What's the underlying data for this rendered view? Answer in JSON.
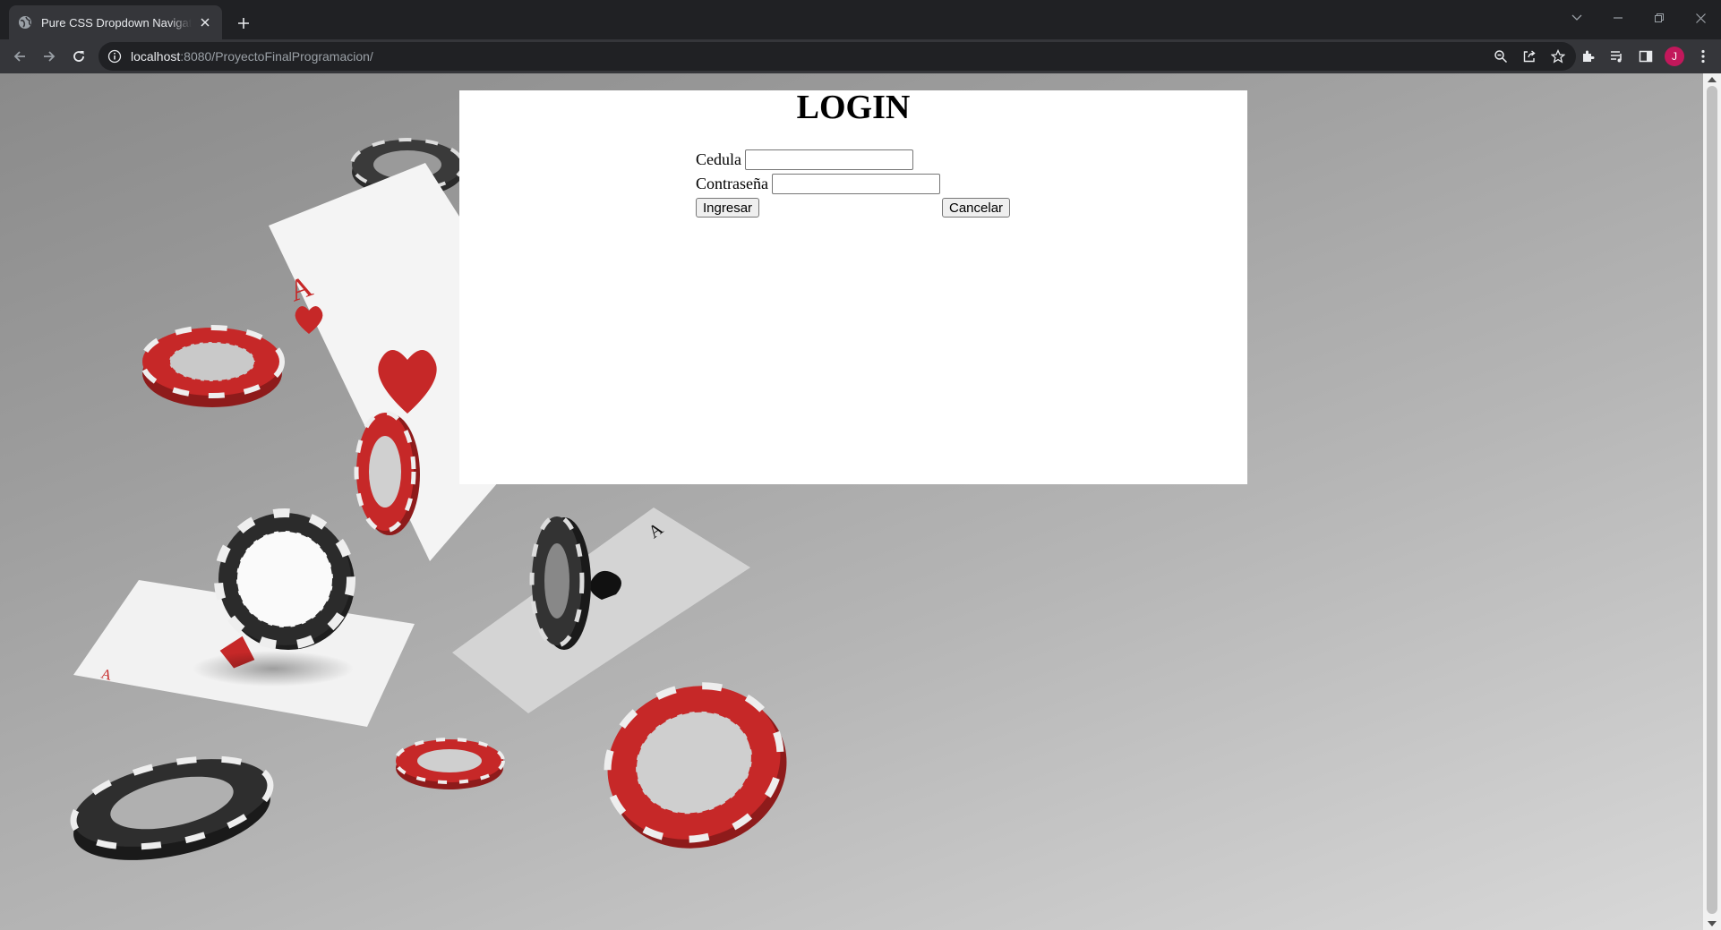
{
  "browser": {
    "tab_title": "Pure CSS Dropdown Navigation Bar",
    "url_host": "localhost",
    "url_rest": ":8080/ProyectoFinalProgramacion/",
    "avatar_initial": "J",
    "accent": "#c2185b"
  },
  "login": {
    "title": "LOGIN",
    "cedula_label": "Cedula",
    "cedula_value": "",
    "password_label": "Contraseña",
    "password_value": "",
    "submit_label": "Ingresar",
    "cancel_label": "Cancelar"
  },
  "icons": [
    "globe-icon",
    "close-icon",
    "plus-icon",
    "chevron-down-icon",
    "minimize-icon",
    "restore-icon",
    "window-close-icon",
    "back-icon",
    "forward-icon",
    "reload-icon",
    "info-icon",
    "zoom-icon",
    "share-icon",
    "star-icon",
    "extensions-icon",
    "media-icon",
    "side-panel-icon",
    "menu-icon"
  ]
}
